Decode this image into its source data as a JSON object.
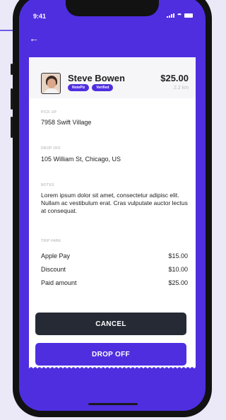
{
  "status_bar": {
    "time": "9:41"
  },
  "nav": {
    "back_icon": "arrow-left-icon"
  },
  "driver": {
    "name": "Steve Bowen",
    "badges": [
      "NotePlz",
      "Verified"
    ],
    "price": "$25.00",
    "distance": "2.2 km"
  },
  "pickup": {
    "label": "PICK UP",
    "value": "7958 Swift Village"
  },
  "dropoff": {
    "label": "DROP OFF",
    "value": "105 William St, Chicago, US"
  },
  "notes": {
    "label": "NOTES",
    "text": "Lorem ipsum dolor sit amet, consectetur adipisc elit. Nullam ac vestibulum erat. Cras vulputate auctor lectus at consequat."
  },
  "fare": {
    "label": "TRIP FARE",
    "rows": [
      {
        "label": "Apple Pay",
        "value": "$15.00"
      },
      {
        "label": "Discount",
        "value": "$10.00"
      },
      {
        "label": "Paid amount",
        "value": "$25.00"
      }
    ]
  },
  "actions": {
    "cancel": "CANCEL",
    "drop_off": "DROP OFF"
  },
  "colors": {
    "accent": "#4f2ee0",
    "dark_button": "#262a35",
    "background": "#ebe9f7"
  }
}
